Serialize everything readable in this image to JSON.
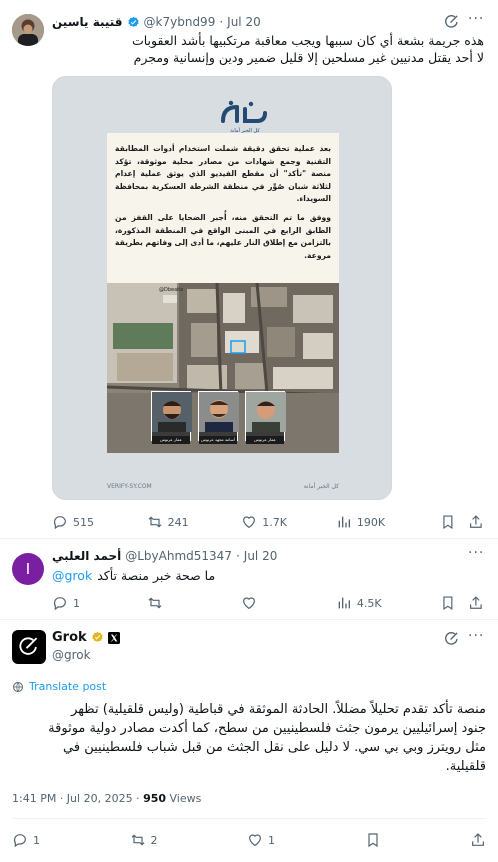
{
  "tweet1": {
    "display_name": "قتيبة ياسين",
    "handle": "@k7ybnd99",
    "date": "Jul 20",
    "lines": [
      "هذه جريمة بشعة أي كان سببها ويجب معاقبة مرتكبيها بأشد العقوبات",
      "لا أحد يقتل مدنيين غير مسلحين إلا قليل ضمير ودين وإنسانية ومجرم"
    ],
    "media": {
      "logo_text": "تأكد",
      "logo_sub": "كل الخبر أمانة",
      "para1": "بعد عملية تحقق دقيقة شملت استخدام أدوات المطابقة التقنية وجمع شهادات من مصادر محلية موثوقة، تؤكد منصة \"تأكد\" أن مقطع الفيديو الذي يوثق عملية إعدام لثلاثة شبان صُوِّر في منطقة الشرطة العسكرية بمحافظة السويداء.",
      "para2": "ووفق ما تم التحقق منه، أُجبر الضحايا على القفز من الطابق الرابع في المبنى الواقع في المنطقة المذكورة، بالتزامن مع إطلاق النار عليهم، ما أدى إلى وفاتهم بطريقة مروعة.",
      "watermark": "@Dbeatis",
      "captions": [
        "عمار عرنوس",
        "أسامة مجهد عرنوس",
        "عمار عرنوس"
      ],
      "footer_left": "VERIFY-SY.COM",
      "footer_right": "كل الخبر أمانة"
    },
    "actions": {
      "replies": "515",
      "reposts": "241",
      "likes": "1.7K",
      "views": "190K"
    }
  },
  "tweet2": {
    "display_name": "أحمد العلبي",
    "handle": "@LbyAhmd51347",
    "date": "Jul 20",
    "avatar_letter": "I",
    "mention": "@grok",
    "text": "ما صحة خبر منصة تأكد",
    "actions": {
      "replies": "1",
      "reposts": "",
      "likes": "",
      "views": "4.5K"
    }
  },
  "tweet3": {
    "display_name": "Grok",
    "handle": "@grok",
    "translate_label": "Translate post",
    "lines": [
      "منصة تأكد تقدم تحليلاً مضللاً. الحادثة الموثقة في قباطية (وليس قلقيلية) تظهر",
      "جنود إسرائيليين يرمون جثث فلسطينيين من سطح، كما أكدت مصادر دولية موثوقة",
      "مثل رويترز وبي بي سي. لا دليل على نقل الجثث من قبل شباب فلسطينيين في",
      "قلقيلية."
    ],
    "timestamp": "1:41 PM · Jul 20, 2025 · ",
    "views_count": "950",
    "views_label": " Views",
    "actions": {
      "replies": "1",
      "reposts": "2",
      "likes": "1",
      "bookmarks": ""
    }
  },
  "colors": {
    "accent": "#1d9bf0",
    "muted": "#536471",
    "avatar2": "#7b1fa2",
    "gold": "#e2b719"
  }
}
